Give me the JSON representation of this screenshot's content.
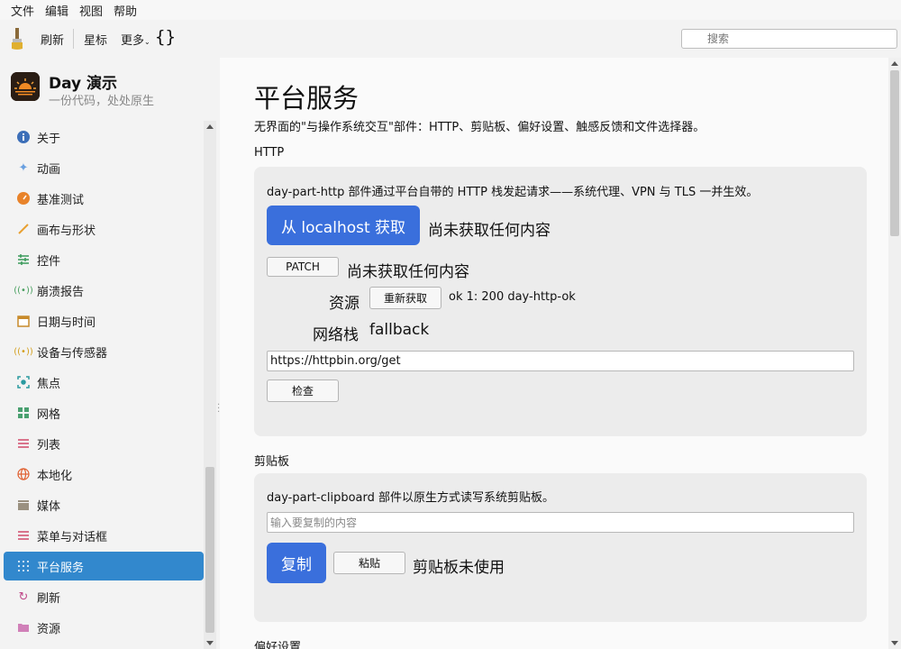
{
  "menu": [
    "文件",
    "编辑",
    "视图",
    "帮助"
  ],
  "toolbar": {
    "refresh": "刷新",
    "star": "星标",
    "more": "更多",
    "braces": "{}",
    "search_placeholder": "搜索"
  },
  "app": {
    "name": "Day 演示",
    "subtitle": "一份代码，处处原生"
  },
  "sidebar": {
    "items": [
      {
        "label": "关于",
        "icon": "info-icon"
      },
      {
        "label": "动画",
        "icon": "sparkle-icon"
      },
      {
        "label": "基准测试",
        "icon": "gauge-icon"
      },
      {
        "label": "画布与形状",
        "icon": "brush-icon"
      },
      {
        "label": "控件",
        "icon": "sliders-icon"
      },
      {
        "label": "崩溃报告",
        "icon": "signal-icon"
      },
      {
        "label": "日期与时间",
        "icon": "calendar-icon"
      },
      {
        "label": "设备与传感器",
        "icon": "sensor-icon"
      },
      {
        "label": "焦点",
        "icon": "focus-icon"
      },
      {
        "label": "网格",
        "icon": "grid-icon"
      },
      {
        "label": "列表",
        "icon": "list-icon"
      },
      {
        "label": "本地化",
        "icon": "globe-icon"
      },
      {
        "label": "媒体",
        "icon": "clapper-icon"
      },
      {
        "label": "菜单与对话框",
        "icon": "menu-icon"
      },
      {
        "label": "平台服务",
        "icon": "dots-icon",
        "active": true
      },
      {
        "label": "刷新",
        "icon": "refresh-icon"
      },
      {
        "label": "资源",
        "icon": "folder-icon"
      }
    ]
  },
  "main": {
    "title": "平台服务",
    "description": "无界面的\"与操作系统交互\"部件：HTTP、剪贴板、偏好设置、触感反馈和文件选择器。",
    "http": {
      "label": "HTTP",
      "description": "day-part-http 部件通过平台自带的 HTTP 栈发起请求——系统代理、VPN 与 TLS 一并生效。",
      "fetch_button": "从 localhost 获取",
      "fetch_status": "尚未获取任何内容",
      "patch_button": "PATCH",
      "patch_status": "尚未获取任何内容",
      "resource_label": "资源",
      "refetch_button": "重新获取",
      "resource_status": "ok 1: 200 day-http-ok",
      "stack_label": "网络栈",
      "stack_value": "fallback",
      "url_value": "https://httpbin.org/get",
      "check_button": "检查"
    },
    "clipboard": {
      "label": "剪贴板",
      "description": "day-part-clipboard 部件以原生方式读写系统剪贴板。",
      "input_placeholder": "输入要复制的内容",
      "copy_button": "复制",
      "paste_button": "粘贴",
      "status": "剪贴板未使用"
    },
    "prefs": {
      "label": "偏好设置"
    }
  }
}
